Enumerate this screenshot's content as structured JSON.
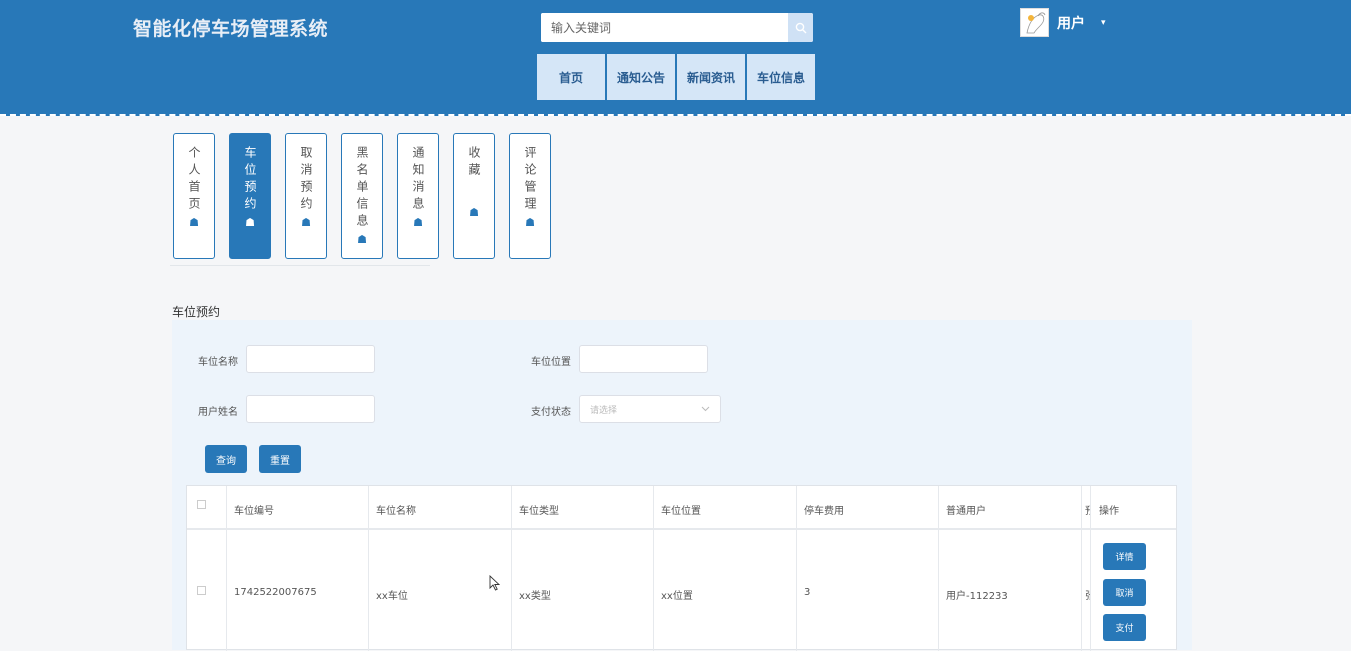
{
  "header": {
    "brand": "智能化停车场管理系统",
    "search_placeholder": "输入关键词",
    "nav": [
      "首页",
      "通知公告",
      "新闻资讯",
      "车位信息"
    ],
    "user_name": "用户"
  },
  "side_tabs": [
    {
      "label": "个人首页",
      "active": false
    },
    {
      "label": "车位预约",
      "active": true
    },
    {
      "label": "取消预约",
      "active": false
    },
    {
      "label": "黑名单信息",
      "active": false
    },
    {
      "label": "通知消息",
      "active": false
    },
    {
      "label": "收藏",
      "active": false
    },
    {
      "label": "评论管理",
      "active": false
    }
  ],
  "section_title": "车位预约",
  "filters": {
    "name_label": "车位名称",
    "location_label": "车位位置",
    "user_label": "用户姓名",
    "pay_label": "支付状态",
    "pay_placeholder": "请选择",
    "query_button": "查询",
    "reset_button": "重置"
  },
  "table": {
    "headers": [
      "车位编号",
      "车位名称",
      "车位类型",
      "车位位置",
      "停车费用",
      "普通用户",
      "操作"
    ],
    "truncated_header": "预",
    "rows": [
      {
        "code": "1742522007675",
        "name": "xx车位",
        "type": "xx类型",
        "location": "xx位置",
        "fee": "3",
        "user": "用户-112233",
        "truncated": "张"
      }
    ],
    "actions": [
      "详情",
      "取消",
      "支付"
    ]
  },
  "colors": {
    "primary": "#2878b8",
    "nav_bg": "#d5e6f7",
    "panel_bg": "#edf4fb"
  }
}
